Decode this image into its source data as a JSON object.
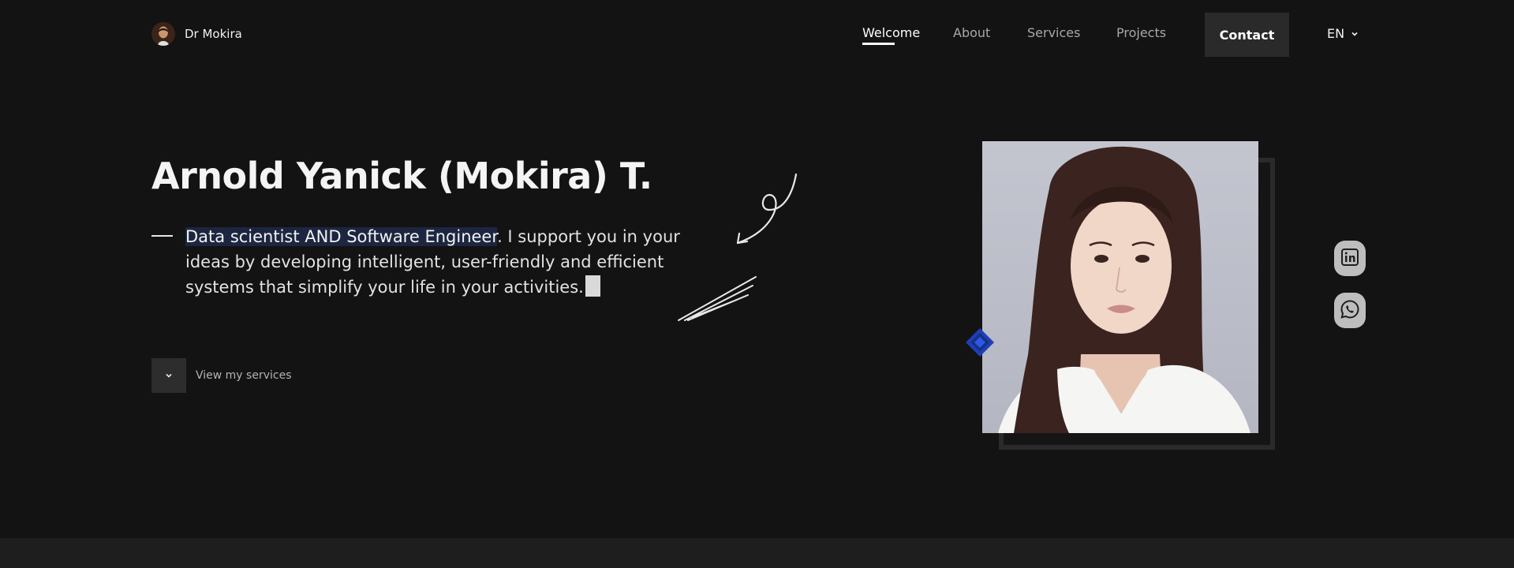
{
  "brand": {
    "name": "Dr Mokira",
    "avatar_icon": "profile-avatar-icon"
  },
  "nav": {
    "links": [
      {
        "label": "Welcome",
        "active": true
      },
      {
        "label": "About",
        "active": false
      },
      {
        "label": "Services",
        "active": false
      },
      {
        "label": "Projects",
        "active": false
      }
    ],
    "contact_label": "Contact",
    "language": "EN"
  },
  "hero": {
    "title": "Arnold Yanick (Mokira) T.",
    "tagline_highlight": "Data scientist AND Software Engineer",
    "tagline_rest": ". I support you in your ideas by developing intelligent, user-friendly and efficient systems that simplify your life in your activities.",
    "cta_label": "View my services"
  },
  "social": {
    "linkedin_icon": "linkedin-icon",
    "whatsapp_icon": "whatsapp-icon"
  },
  "colors": {
    "background": "#131313",
    "accent_blue": "#1f4fd6",
    "highlight": "#1d2640",
    "button": "#2a2a2a"
  }
}
